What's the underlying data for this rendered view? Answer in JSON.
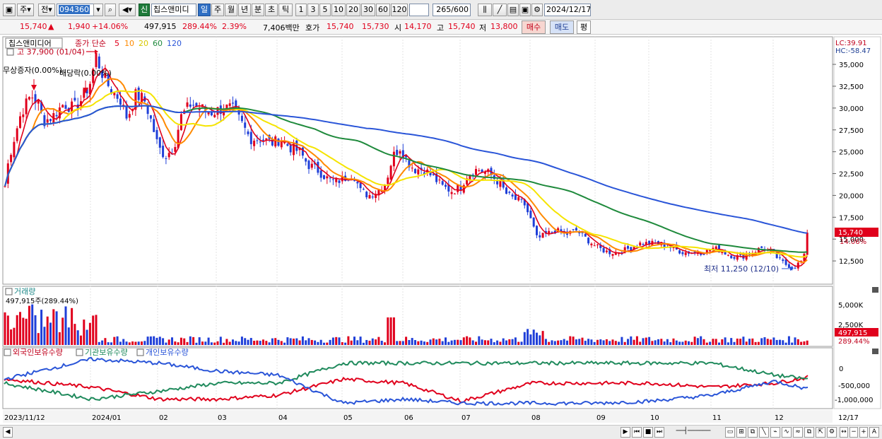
{
  "toolbar": {
    "period_main": "주",
    "market": "전",
    "code": "094360",
    "stock_name": "칩스앤미디",
    "badge_new": "신",
    "periods": [
      "일",
      "주",
      "월",
      "년",
      "분",
      "초",
      "틱"
    ],
    "selected_period": "일",
    "intervals": [
      "1",
      "3",
      "5",
      "10",
      "20",
      "30",
      "60",
      "120"
    ],
    "count": "265",
    "count_total": "/600",
    "date": "2024/12/17"
  },
  "quote": {
    "price": "15,740",
    "change": "1,940",
    "change_pct": "+14.06%",
    "volume": "497,915",
    "volume_pct": "289.44%",
    "turnover_pct": "2.39%",
    "amount": "7,406백만",
    "ask_label": "호가",
    "ask": "15,740",
    "bid": "15,730",
    "open_label": "시",
    "open": "14,170",
    "high_label": "고",
    "high": "15,740",
    "low_label": "저",
    "low": "13,800",
    "buy_label": "매수",
    "sell_label": "매도",
    "flat_label": "평"
  },
  "chart": {
    "legend_title": "칩스앤미디어",
    "legend_type": "종가 단순",
    "ma_labels": [
      "5",
      "10",
      "20",
      "60",
      "120"
    ],
    "ma_colors": [
      "#e0001c",
      "#ff8a00",
      "#f5e400",
      "#1f8a3c",
      "#2a55d8"
    ],
    "high_marker": "고 37,900 (01/04)",
    "event1": "무상증자(0.00%)",
    "event2": "배당락(0.00%)",
    "low_marker": "최저 11,250 (12/10)",
    "lc": "LC:39.91",
    "hc": "HC:-58.47",
    "price_ticks": [
      "35,000",
      "32,500",
      "30,000",
      "27,500",
      "25,000",
      "22,500",
      "20,000",
      "17,500",
      "15,000",
      "12,500"
    ],
    "last_price": "15,740",
    "last_pct": "14.06%",
    "volume_title": "거래량",
    "volume_value": "497,915주(289.44%)",
    "volume_ticks": [
      "5,000K",
      "2,500K"
    ],
    "volume_last": "497,915",
    "volume_last_pct": "289.44%",
    "holding_series": [
      "외국인보유수량",
      "기관보유수량",
      "개인보유수량"
    ],
    "holding_colors": [
      "#e0001c",
      "#1f8a5c",
      "#2a55d8"
    ],
    "holding_ticks": [
      "0",
      "-500,000",
      "-1,000,000"
    ],
    "x_ticks": [
      "2023/11/12",
      "2024/01",
      "02",
      "03",
      "04",
      "05",
      "06",
      "07",
      "08",
      "09",
      "10",
      "11",
      "12",
      "12/17"
    ]
  },
  "chart_data": {
    "type": "candlestick",
    "title": "칩스앤미디어",
    "x": [
      "2023/11",
      "2024/01",
      "02",
      "03",
      "04",
      "05",
      "06",
      "07",
      "08",
      "09",
      "10",
      "11",
      "12",
      "12/17"
    ],
    "close_approx": [
      18000,
      34000,
      26000,
      30000,
      26500,
      20500,
      25500,
      22500,
      14500,
      13000,
      14000,
      13000,
      11500,
      15740
    ],
    "ylim": [
      10000,
      38000
    ],
    "series": [
      {
        "name": "외국인보유수량",
        "values": [
          -400000,
          -600000,
          -900000,
          -900000,
          -800000,
          -400000,
          -500000,
          -950000,
          -500000,
          -500000,
          -500000,
          -600000,
          -500000,
          -350000
        ]
      },
      {
        "name": "기관보유수량",
        "values": [
          -500000,
          -900000,
          -700000,
          -500000,
          -500000,
          0,
          0,
          0,
          0,
          0,
          0,
          0,
          -300000,
          -400000
        ]
      },
      {
        "name": "개인보유수량",
        "values": [
          -400000,
          100000,
          0,
          -200000,
          -300000,
          -1000000,
          -900000,
          -1000000,
          -1000000,
          -1000000,
          -950000,
          -800000,
          -450000,
          -650000
        ]
      }
    ]
  }
}
